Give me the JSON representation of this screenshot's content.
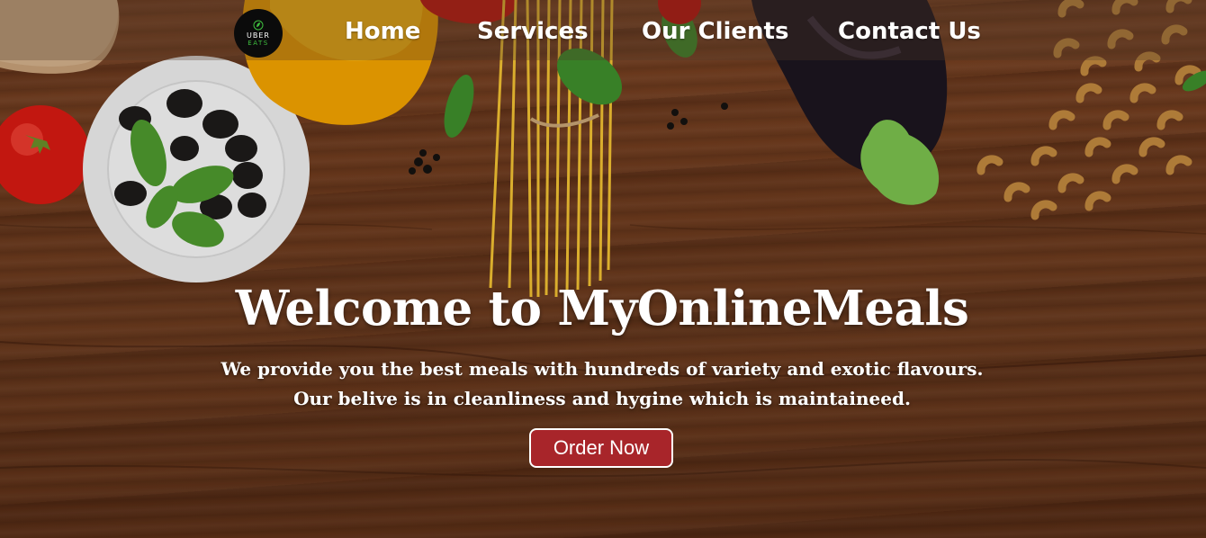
{
  "nav": {
    "logo": {
      "line1": "UBER",
      "line2": "EATS"
    },
    "links": [
      "Home",
      "Services",
      "Our Clients",
      "Contact Us"
    ]
  },
  "hero": {
    "title": "Welcome to MyOnlineMeals",
    "line1": "We provide you the best meals with hundreds of variety and exotic flavours.",
    "line2": "Our belive is in cleanliness and hygine which is maintaineed.",
    "button": "Order Now"
  },
  "colors": {
    "button_bg": "#a8252a",
    "text": "#ffffff",
    "wood": "#6d3a1d"
  }
}
